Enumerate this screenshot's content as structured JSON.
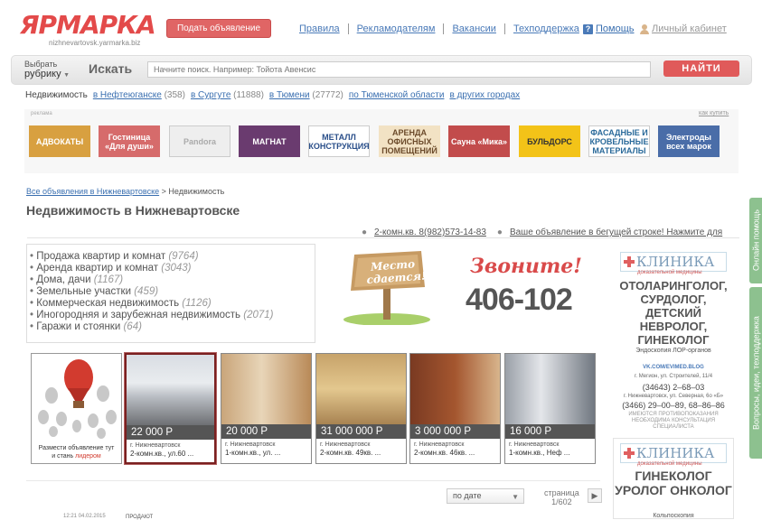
{
  "header": {
    "logo": "ЯРМАРКА",
    "logo_sub": "nizhnevartovsk.yarmarka.biz",
    "post_button": "Подать объявление",
    "nav": [
      "Правила",
      "Рекламодателям",
      "Вакансии",
      "Техподдержка"
    ],
    "help": "Помощь",
    "cabinet": "Личный кабинет"
  },
  "search": {
    "rubric_line1": "Выбрать",
    "rubric_line2": "рубрику",
    "label": "Искать",
    "placeholder": "Начните поиск. Например: Тойота Авенсис",
    "button": "НАЙТИ"
  },
  "regions": {
    "title": "Недвижимость",
    "items": [
      {
        "label": "в Нефтеюганске",
        "count": "(358)"
      },
      {
        "label": "в Сургуте",
        "count": "(11888)"
      },
      {
        "label": "в Тюмени",
        "count": "(27772)"
      },
      {
        "label": "по Тюменской области",
        "count": ""
      },
      {
        "label": "в других городах",
        "count": ""
      }
    ]
  },
  "ads": {
    "label": "реклама",
    "close": "как купить",
    "tiles": [
      {
        "text": "АДВОКАТЫ",
        "bg": "#d8a040",
        "fg": "#ffffff"
      },
      {
        "text": "Гостиница «Для души»",
        "bg": "#d66b6b",
        "fg": "#ffffff"
      },
      {
        "text": "Pandora",
        "bg": "#eeeeee",
        "fg": "#aaaaaa"
      },
      {
        "text": "МАГНАТ",
        "bg": "#6a3b6f",
        "fg": "#ffffff"
      },
      {
        "text": "МЕТАЛЛ КОНСТРУКЦИЯ",
        "bg": "#ffffff",
        "fg": "#2a4f8a"
      },
      {
        "text": "АРЕНДА ОФИСНЫХ ПОМЕЩЕНИЙ",
        "bg": "#f2e2c4",
        "fg": "#6b4a2a"
      },
      {
        "text": "Сауна «Мика»",
        "bg": "#c24c4c",
        "fg": "#ffffff"
      },
      {
        "text": "БУЛЬДОРС",
        "bg": "#f3c318",
        "fg": "#333333"
      },
      {
        "text": "ФАСАДНЫЕ И КРОВЕЛЬНЫЕ МАТЕРИАЛЫ",
        "bg": "#ffffff",
        "fg": "#2a6a9a"
      },
      {
        "text": "Электроды всех марок",
        "bg": "#4a6da8",
        "fg": "#ffffff"
      }
    ]
  },
  "breadcrumb": {
    "link": "Все объявления в Нижневартовске",
    "sep": " > ",
    "current": "Недвижимость"
  },
  "page_title": "Недвижимость в Нижневартовске",
  "ticker": {
    "item1": "2-комн.кв. 8(982)573-14-83",
    "item2": "Ваше объявление в бегущей строке! Нажмите для"
  },
  "categories": [
    {
      "label": "Продажа квартир и комнат",
      "count": "(9764)"
    },
    {
      "label": "Аренда квартир и комнат",
      "count": "(3043)"
    },
    {
      "label": "Дома, дачи",
      "count": "(1167)"
    },
    {
      "label": "Земельные участки",
      "count": "(459)"
    },
    {
      "label": "Коммерческая недвижимость",
      "count": "(1126)"
    },
    {
      "label": "Иногородняя и зарубежная недвижимость",
      "count": "(2071)"
    },
    {
      "label": "Гаражи и стоянки",
      "count": "(64)"
    }
  ],
  "promo": {
    "sign_line1": "Место",
    "sign_line2": "сдается!",
    "call": "Звоните!",
    "phone": "406-102"
  },
  "clinic1": {
    "name": "КЛИНИКА",
    "tag": "доказательной медицины",
    "specs": "ОТОЛАРИНГОЛОГ, СУРДОЛОГ, ДЕТСКИЙ НЕВРОЛОГ, ГИНЕКОЛОГ",
    "sub": "Эндоскопия ЛОР-органов",
    "vk": "VK.COM/EVIMED.BLOG",
    "addr1": "г. Мегион, ул. Строителей, 11/4",
    "phone1": "(34643) 2–68–03",
    "addr2": "г. Нижневартовск, ул. Северная, 6о «Б»",
    "phone2": "(3466) 29–00–89, 68–86–86",
    "note": "ИМЕЮТСЯ ПРОТИВОПОКАЗАНИЯ НЕОБХОДИМА КОНСУЛЬТАЦИЯ СПЕЦИАЛИСТА"
  },
  "clinic2": {
    "name": "КЛИНИКА",
    "tag": "доказательной медицины",
    "specs": "ГИНЕКОЛОГ УРОЛОГ ОНКОЛОГ",
    "sub": "Кольпоскопия"
  },
  "side_tabs": {
    "tab1": "Онлайн помощь",
    "tab2": "Вопросы, идеи, техподдержка"
  },
  "promo_tile": {
    "line1": "Размести объявление тут",
    "line2": "и стань ",
    "accent": "лидером"
  },
  "listings": [
    {
      "price": "22 000 Р",
      "city": "г. Нижневартовск",
      "desc": "2-комн.кв., ул.60 ..."
    },
    {
      "price": "20 000 Р",
      "city": "г. Нижневартовск",
      "desc": "1-комн.кв., ул. ..."
    },
    {
      "price": "31 000 000 Р",
      "city": "г. Нижневартовск",
      "desc": "2-комн.кв. 49кв. ..."
    },
    {
      "price": "3 000 000 Р",
      "city": "г. Нижневартовск",
      "desc": "2-комн.кв. 46кв. ..."
    },
    {
      "price": "16 000 Р",
      "city": "г. Нижневартовск",
      "desc": "1-комн.кв., Неф ..."
    }
  ],
  "sorting": {
    "selected": "по дате"
  },
  "pager": {
    "label": "страница",
    "value": "1/602"
  },
  "bottom": {
    "date": "12:21 04.02.2015",
    "status": "ПРОДАЮТ"
  }
}
